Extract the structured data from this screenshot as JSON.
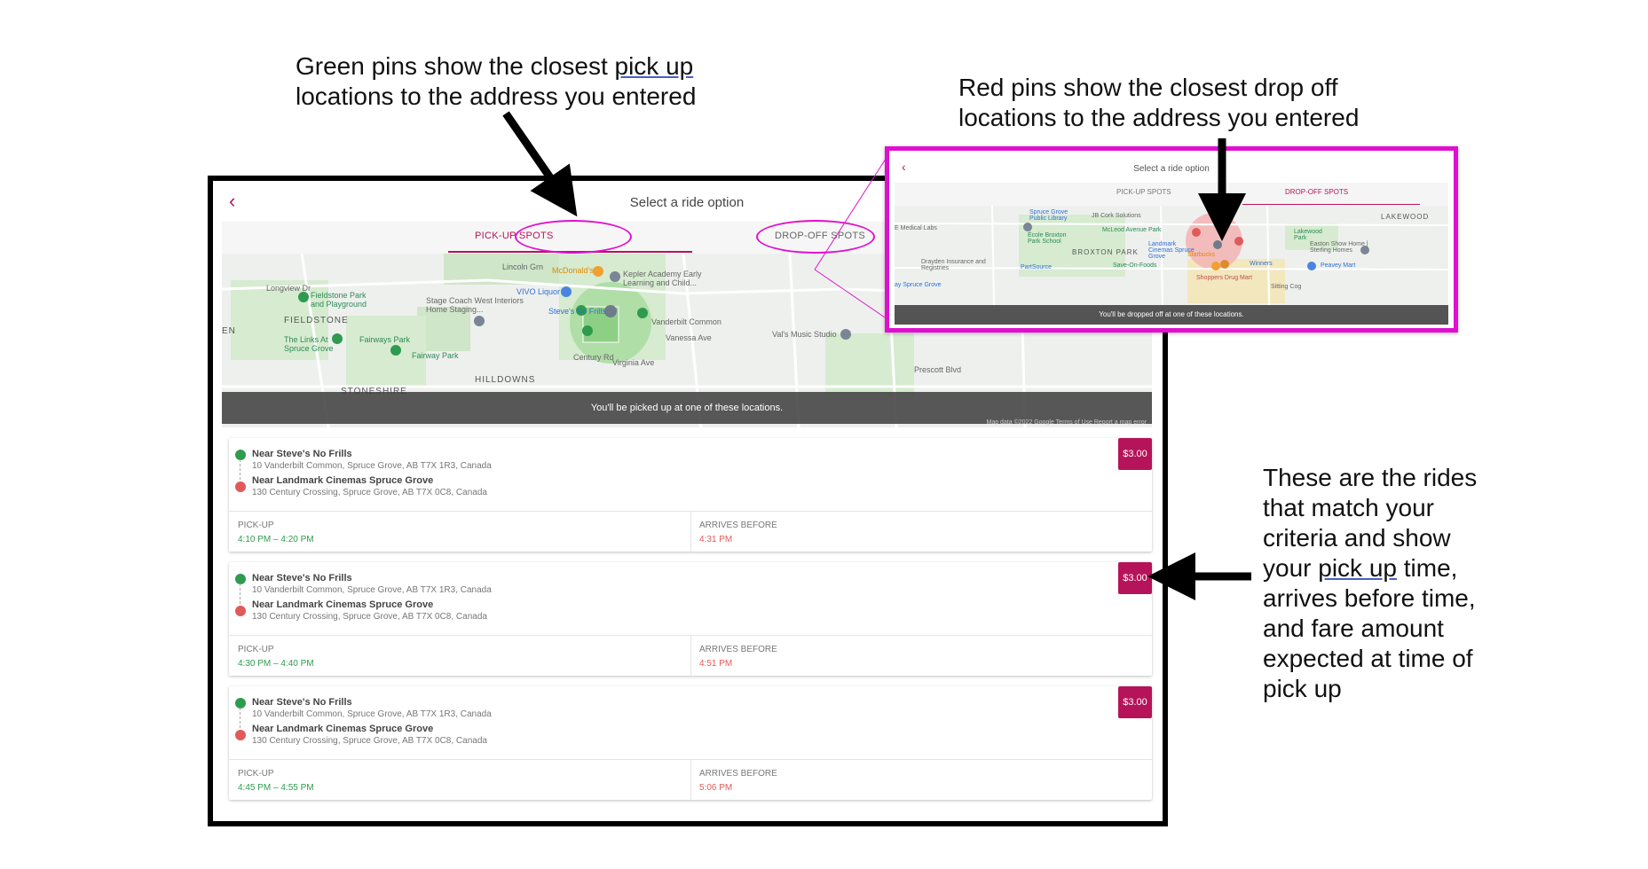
{
  "annotations": {
    "green": {
      "line1a": "Green pins show the closest ",
      "line1b": "pick up",
      "line2": "locations to the address you entered"
    },
    "red": {
      "line1": "Red pins show the closest drop off",
      "line2": "locations to the address you entered"
    },
    "rides": {
      "line1": "These are the rides",
      "line2": "that match your",
      "line3": "criteria and show",
      "line4a": "your ",
      "line4b": "pick up",
      "line4c": " time,",
      "line5": "arrives before time,",
      "line6": "and fare amount",
      "line7": "expected at time of",
      "line8": "pick up"
    }
  },
  "app": {
    "back_icon": "chevron-left-icon",
    "title": "Select a ride option",
    "tabs": {
      "pickup": "PICK-UP SPOTS",
      "dropoff": "DROP-OFF SPOTS"
    },
    "accent_color": "#b5145a"
  },
  "map": {
    "labels": {
      "fieldstone": "FIELDSTONE",
      "fieldstone_park": "Fieldstone Park and Playground",
      "links": "The Links At Spruce Grove",
      "fairways": "Fairways Park",
      "fairway": "Fairway Park",
      "mcdonalds": "McDonald's",
      "vivo": "VIVO Liquor",
      "stagecoach": "Stage Coach West Interiors Home Staging...",
      "steves": "Steve's No Frills",
      "kepler": "Kepler Academy Early Learning and Child...",
      "vals": "Val's Music Studio",
      "hilldowns": "HILLDOWNS",
      "stoneshire": "STONESHIRE",
      "en": "EN",
      "lincoln": "Lincoln Grn",
      "longview": "Longview Dr",
      "vanderbilt": "Vanderbilt Common",
      "vanessa": "Vanessa Ave",
      "virginia": "Virginia Ave",
      "century": "Century Rd",
      "prescott": "Prescott Blvd"
    },
    "footer": "You'll be picked up at one of these locations.",
    "attribution": "Map data ©2022 Google   Terms of Use   Report a map error"
  },
  "rides": [
    {
      "pickup_name": "Near Steve's No Frills",
      "pickup_addr": "10 Vanderbilt Common, Spruce Grove, AB T7X 1R3, Canada",
      "dropoff_name": "Near Landmark Cinemas Spruce Grove",
      "dropoff_addr": "130 Century Crossing, Spruce Grove, AB T7X 0C8, Canada",
      "fare": "$3.00",
      "pickup_label": "PICK-UP",
      "pickup_time": "4:10 PM – 4:20 PM",
      "arrive_label": "ARRIVES BEFORE",
      "arrive_time": "4:31 PM"
    },
    {
      "pickup_name": "Near Steve's No Frills",
      "pickup_addr": "10 Vanderbilt Common, Spruce Grove, AB T7X 1R3, Canada",
      "dropoff_name": "Near Landmark Cinemas Spruce Grove",
      "dropoff_addr": "130 Century Crossing, Spruce Grove, AB T7X 0C8, Canada",
      "fare": "$3.00",
      "pickup_label": "PICK-UP",
      "pickup_time": "4:30 PM – 4:40 PM",
      "arrive_label": "ARRIVES BEFORE",
      "arrive_time": "4:51 PM"
    },
    {
      "pickup_name": "Near Steve's No Frills",
      "pickup_addr": "10 Vanderbilt Common, Spruce Grove, AB T7X 1R3, Canada",
      "dropoff_name": "Near Landmark Cinemas Spruce Grove",
      "dropoff_addr": "130 Century Crossing, Spruce Grove, AB T7X 0C8, Canada",
      "fare": "$3.00",
      "pickup_label": "PICK-UP",
      "pickup_time": "4:45 PM – 4:55 PM",
      "arrive_label": "ARRIVES BEFORE",
      "arrive_time": "5:06 PM"
    }
  ],
  "inset": {
    "title": "Select a ride option",
    "tabs": {
      "pickup": "PICK-UP SPOTS",
      "dropoff": "DROP-OFF SPOTS"
    },
    "labels": {
      "lakewood": "LAKEWOOD",
      "broxton": "BROXTON PARK",
      "library": "Spruce Grove Public Library",
      "jbcork": "JB Cork Solutions",
      "mcleod": "McLeod Avenue Park",
      "landmark": "Landmark Cinemas Spruce Grove",
      "starbucks": "Starbucks",
      "shoppers": "Shoppers Drug Mart",
      "winners": "Winners",
      "peavey": "Peavey Mart",
      "easton": "Easton Show Home | Sterling Homes",
      "lakewood_park": "Lakewood Park",
      "ecole": "École Broxton Park School",
      "drayden": "Drayden Insurance and Registries",
      "partsource": "PartSource",
      "saveon": "Save-On-Foods",
      "medical": "E Medical Labs",
      "sitting": "Sitting Cog",
      "spruce": "ay Spruce Grove"
    },
    "footer": "You'll be dropped off at one of these locations."
  }
}
